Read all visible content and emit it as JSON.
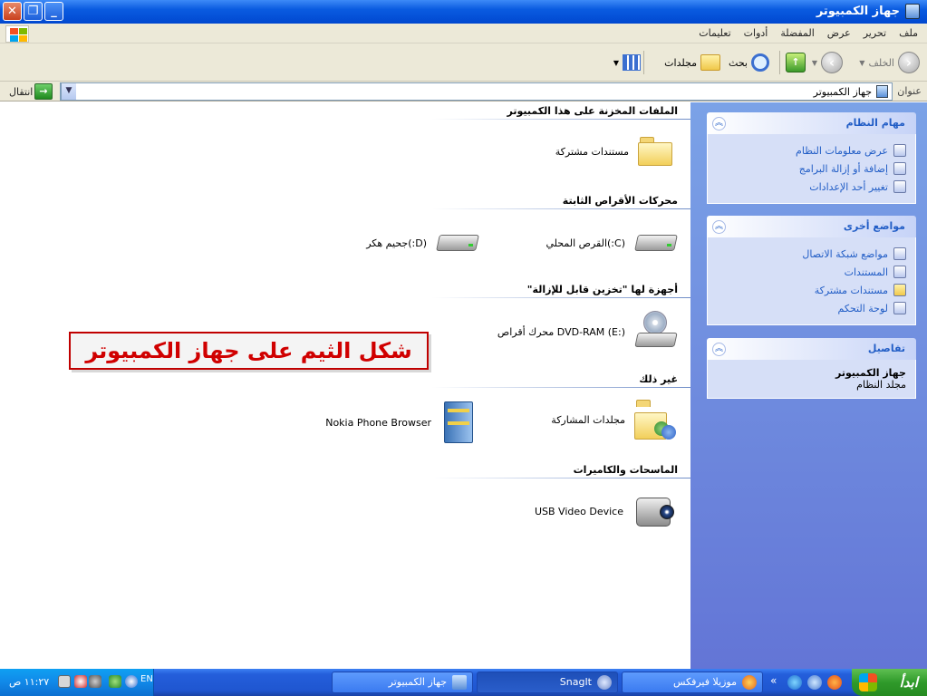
{
  "window": {
    "title": "جهاز الكمبيوتر",
    "buttons": {
      "close": "✕",
      "restore": "❐",
      "minimize": "_"
    }
  },
  "menu": [
    "ملف",
    "تحرير",
    "عرض",
    "المفضلة",
    "أدوات",
    "تعليمات"
  ],
  "toolbar": {
    "back_label": "الخلف",
    "search_label": "بحث",
    "folders_label": "مجلدات"
  },
  "address": {
    "label": "عنوان",
    "value": "جهاز الكمبيوتر",
    "go_label": "انتقال"
  },
  "sidepane": {
    "system_tasks": {
      "title": "مهام النظام",
      "items": [
        "عرض معلومات النظام",
        "إضافة أو إزالة البرامج",
        "تغيير أحد الإعدادات"
      ]
    },
    "other_places": {
      "title": "مواضع أخرى",
      "items": [
        "مواضع شبكة الاتصال",
        "المستندات",
        "مستندات مشتركة",
        "لوحة التحكم"
      ]
    },
    "details": {
      "title": "تفاصيل",
      "name": "جهاز الكمبيوتر",
      "type": "مجلد النظام"
    }
  },
  "content": {
    "groups": [
      {
        "title": "الملفات المخزنة على هذا الكمبيوتر",
        "items": [
          "مستندات مشتركة"
        ]
      },
      {
        "title": "محركات الأقراص الثابتة",
        "items": [
          "(C:)القرص المحلي",
          "(D:)جحيم هكر"
        ]
      },
      {
        "title": "أجهزة لها \"تخزين قابل للإزالة\"",
        "items": [
          "DVD-RAM (E:) محرك أقراص"
        ]
      },
      {
        "title": "غير ذلك",
        "items": [
          "مجلدات المشاركة",
          "Nokia Phone Browser"
        ]
      },
      {
        "title": "الماسحات والكاميرات",
        "items": [
          "USB Video Device"
        ]
      }
    ]
  },
  "annotation": "شكل الثيم على جهاز الكمبيوتر",
  "taskbar": {
    "start_label": "ابدأ",
    "tasks": [
      "موزيلا فيرفكس",
      "SnagIt",
      "جهاز الكمبيوتر"
    ],
    "more_label": "«",
    "lang": "EN",
    "clock": "١١:٢٧ ص"
  }
}
